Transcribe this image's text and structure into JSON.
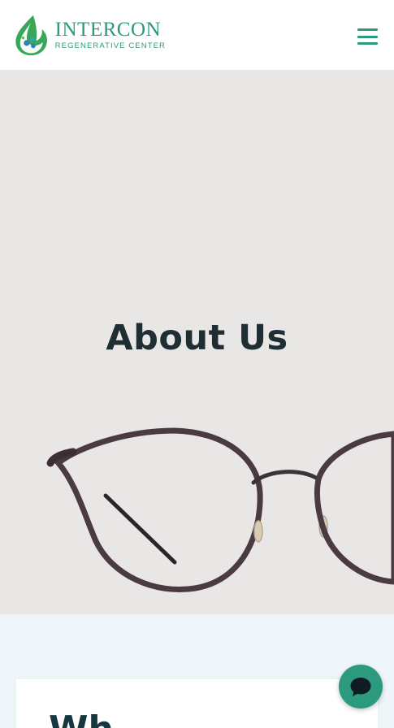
{
  "header": {
    "brand_name": "INTERCON",
    "brand_tagline": "REGENERATIVE CENTER",
    "menu_icon": "hamburger-icon"
  },
  "hero": {
    "title": "About Us",
    "image": "round-eyeglasses"
  },
  "card": {
    "heading": "Wh"
  },
  "chat": {
    "icon": "chat-bubble-icon"
  },
  "colors": {
    "brand": "#2c9a7e",
    "hero_background": "#e8e7e5",
    "title_text": "#1e2e32",
    "page_background": "#eef6fa"
  }
}
